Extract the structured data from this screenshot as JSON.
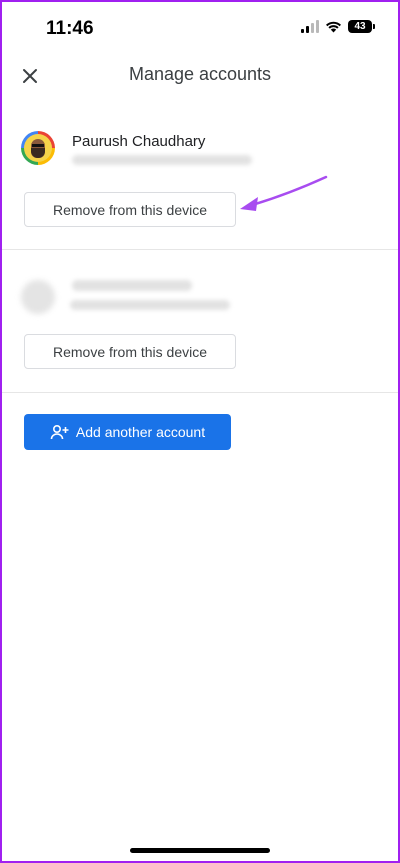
{
  "status_bar": {
    "time": "11:46",
    "battery": "43"
  },
  "header": {
    "title": "Manage accounts",
    "close_icon": "close-icon"
  },
  "accounts": [
    {
      "name": "Paurush Chaudhary",
      "remove_label": "Remove from this device"
    },
    {
      "remove_label": "Remove from this device"
    }
  ],
  "add_account": {
    "label": "Add another account",
    "icon": "person-add-icon"
  },
  "colors": {
    "accent": "#1a73e8",
    "frame": "#a020f0",
    "annotation_arrow": "#a84cf0"
  }
}
